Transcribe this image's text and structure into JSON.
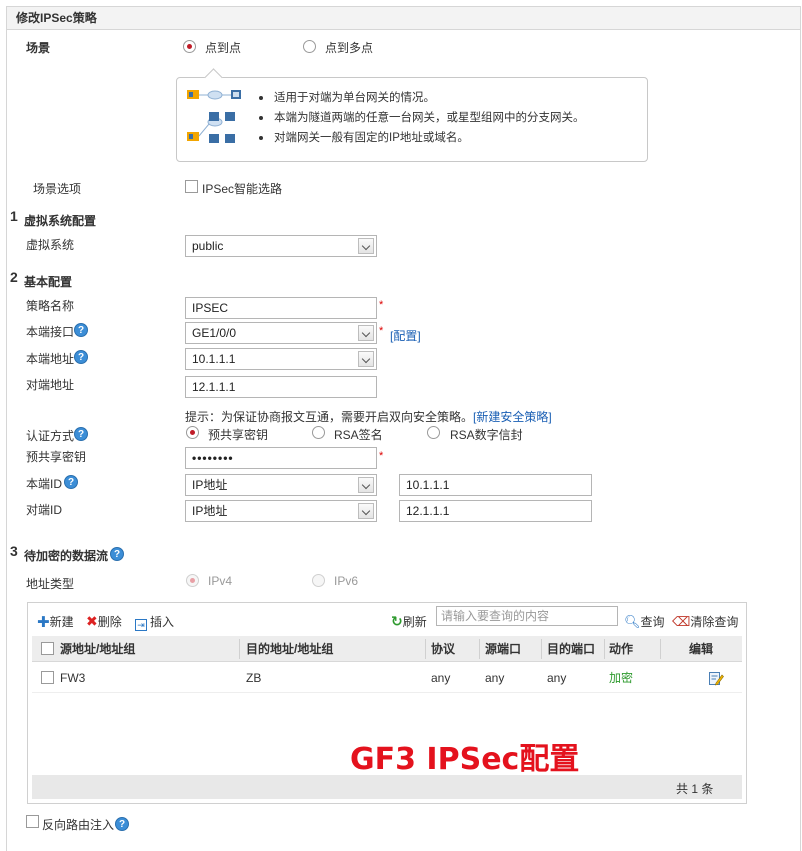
{
  "title": "修改IPSec策略",
  "scene": {
    "label": "场景",
    "options": [
      "点到点",
      "点到多点"
    ],
    "selected": "点到点",
    "bullets": [
      "适用于对端为单台网关的情况。",
      "本端为隧道两端的任意一台网关，或星型组网中的分支网关。",
      "对端网关一般有固定的IP地址或域名。"
    ]
  },
  "scene_option": {
    "label": "场景选项",
    "checkbox_label": "IPSec智能选路"
  },
  "section1": {
    "num": "1",
    "title": "虚拟系统配置",
    "vsys_label": "虚拟系统",
    "vsys_value": "public"
  },
  "section2": {
    "num": "2",
    "title": "基本配置",
    "policy_name_label": "策略名称",
    "policy_name_value": "IPSEC",
    "local_if_label": "本端接口",
    "local_if_value": "GE1/0/0",
    "config_link": "[配置]",
    "local_addr_label": "本端地址",
    "local_addr_value": "10.1.1.1",
    "peer_addr_label": "对端地址",
    "peer_addr_value": "12.1.1.1",
    "hint_text": "提示：为保证协商报文互通，需要开启双向安全策略。",
    "hint_link": "[新建安全策略]",
    "auth_label": "认证方式",
    "auth_options": [
      "预共享密钥",
      "RSA签名",
      "RSA数字信封"
    ],
    "psk_label": "预共享密钥",
    "psk_value": "••••••••",
    "local_id_label": "本端ID",
    "local_id_type": "IP地址",
    "local_id_value": "10.1.1.1",
    "peer_id_label": "对端ID",
    "peer_id_type": "IP地址",
    "peer_id_value": "12.1.1.1"
  },
  "section3": {
    "num": "3",
    "title": "待加密的数据流",
    "addr_type_label": "地址类型",
    "addr_types": [
      "IPv4",
      "IPv6"
    ]
  },
  "toolbar": {
    "new": "新建",
    "delete": "删除",
    "insert": "插入",
    "refresh": "刷新",
    "search_placeholder": "请输入要查询的内容",
    "query": "查询",
    "clear_query": "清除查询"
  },
  "table": {
    "headers": [
      "源地址/地址组",
      "目的地址/地址组",
      "协议",
      "源端口",
      "目的端口",
      "动作",
      "编辑"
    ],
    "rows": [
      {
        "src": "FW3",
        "dst": "ZB",
        "proto": "any",
        "sport": "any",
        "dport": "any",
        "action": "加密"
      }
    ],
    "footer": "共 1 条"
  },
  "watermark": "GF3 IPSec配置",
  "reverse_route": "反向路由注入",
  "colors": {
    "accent_red": "#c01c28",
    "link_blue": "#1a5fb4",
    "action_green": "#2e9a2e",
    "watermark_red": "#e4121d"
  }
}
